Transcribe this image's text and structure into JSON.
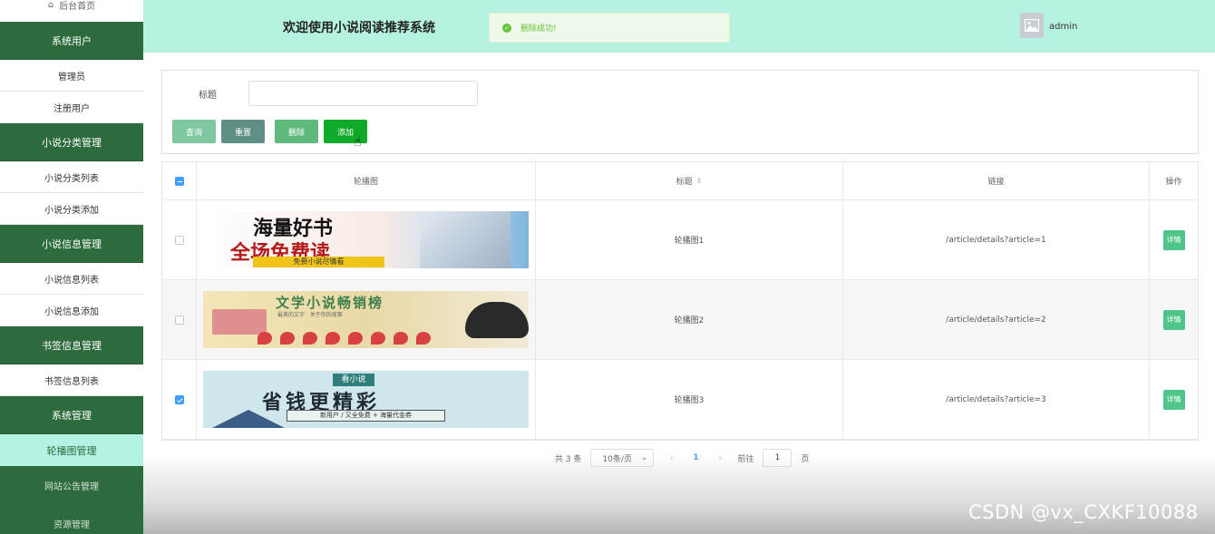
{
  "sidebar": {
    "home": "后台首页",
    "groups": [
      {
        "title": "系统用户",
        "items": [
          "管理员",
          "注册用户"
        ]
      },
      {
        "title": "小说分类管理",
        "items": [
          "小说分类列表",
          "小说分类添加"
        ]
      },
      {
        "title": "小说信息管理",
        "items": [
          "小说信息列表",
          "小说信息添加"
        ]
      },
      {
        "title": "书签信息管理",
        "items": [
          "书签信息列表"
        ]
      },
      {
        "title": "系统管理",
        "items": []
      }
    ],
    "active": "轮播图管理",
    "more": [
      "网站公告管理",
      "资源管理"
    ]
  },
  "header": {
    "title": "欢迎使用小说阅读推荐系统",
    "toast": "删除成功!",
    "username": "admin"
  },
  "search": {
    "label": "标题",
    "value": "",
    "buttons": {
      "query": "查询",
      "reset": "重置",
      "delete": "删除",
      "add": "添加"
    }
  },
  "table": {
    "columns": [
      "轮播图",
      "标题",
      "链接",
      "操作"
    ],
    "rows": [
      {
        "checked": false,
        "banner": {
          "line1": "海量好书",
          "line2": "全场免费读",
          "strip": "免费小说尽情看"
        },
        "title": "轮播图1",
        "link": "/article/details?article=1",
        "action": "详情"
      },
      {
        "checked": false,
        "banner": {
          "line1": "文学小说畅销榜",
          "sub": "最美的文字 · 关于你的故事"
        },
        "title": "轮播图2",
        "link": "/article/details?article=2",
        "action": "详情"
      },
      {
        "checked": true,
        "banner": {
          "tag": "看小说",
          "line1": "省钱更精彩",
          "sub": "新用户 / 又全免费 + 海量代金券"
        },
        "title": "轮播图3",
        "link": "/article/details?article=3",
        "action": "详情"
      }
    ]
  },
  "pagination": {
    "total": "共 3 条",
    "page_size": "10条/页",
    "current": "1",
    "goto_label": "前往",
    "goto_value": "1",
    "page_suffix": "页"
  },
  "watermark": "CSDN @vx_CXKF10088",
  "colors": {
    "sidebar_group": "#2d6b3c",
    "header_bg": "#b6f2e1",
    "active_item": "#b4f3e3",
    "primary": "#409eff",
    "success": "#67c23a"
  }
}
